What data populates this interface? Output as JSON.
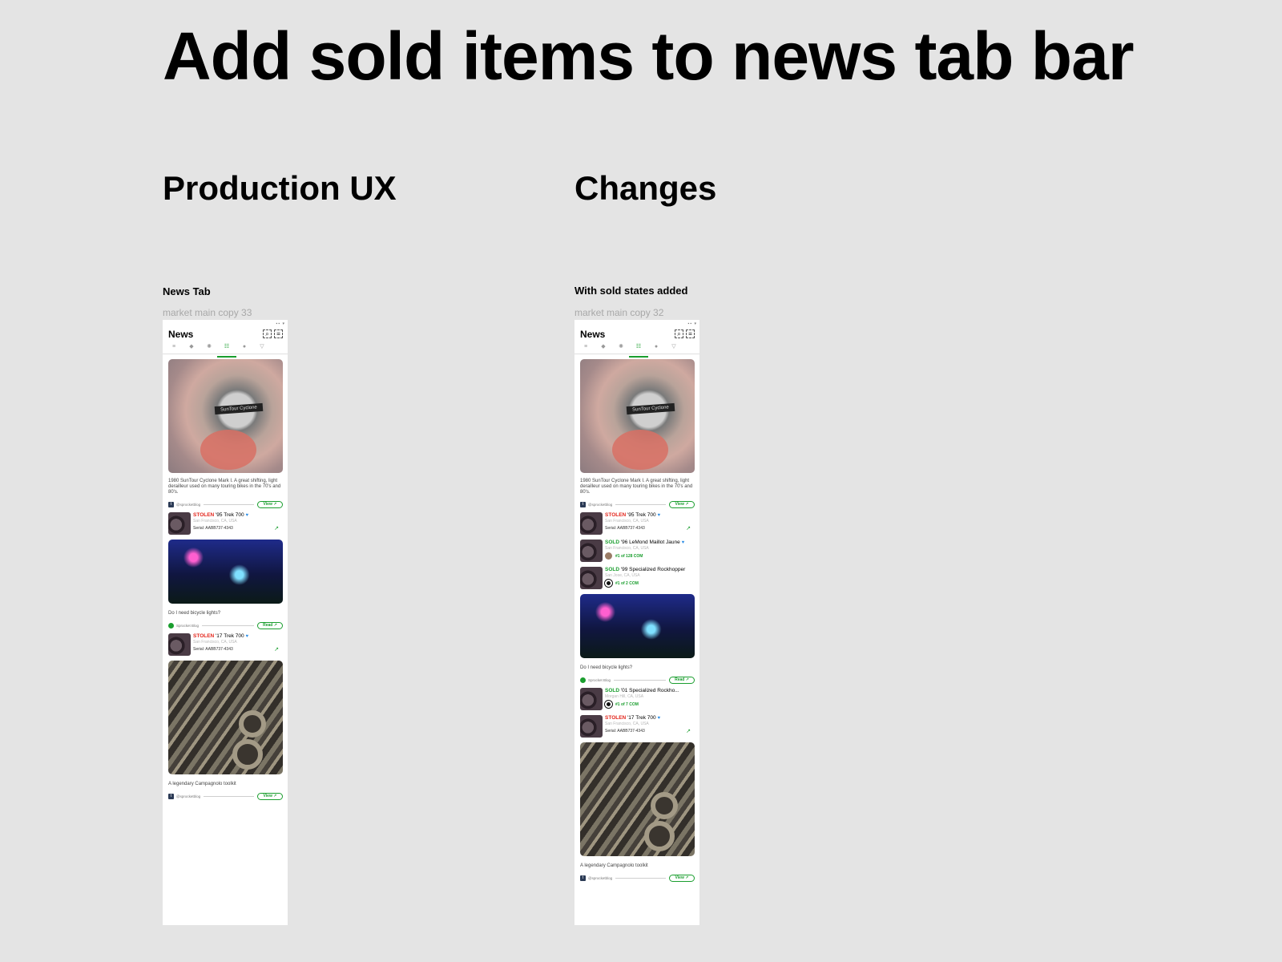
{
  "page": {
    "title": "Add sold items to news tab bar",
    "left_heading": "Production UX",
    "right_heading": "Changes"
  },
  "frames": [
    {
      "label": "News Tab",
      "sub": "market main copy 33",
      "app_title": "News",
      "tabs": [
        "menu-icon",
        "tag-icon",
        "wheel-icon",
        "news-icon",
        "person-icon",
        "filter-icon"
      ],
      "active_tab": 3,
      "feed": {
        "article1": {
          "caption": "1980 SunTour Cyclone Mark I. A great shifting, light derailleur used on many touring bikes in the 70's and 80's.",
          "source": "@sprocketblog",
          "button": "View",
          "image_text": "SunTour Cyclone"
        },
        "bike1": {
          "status": "STOLEN",
          "name": "'95 Trek 700",
          "location": "San Francisco, CA, USA",
          "serial": "Serial: AABB737-4343"
        },
        "article2": {
          "caption": "Do I need bicycle lights?",
          "source": "Sprocket Blog",
          "button": "Read"
        },
        "bike2": {
          "status": "STOLEN",
          "name": "'17 Trek 700",
          "location": "San Francisco, CA, USA",
          "serial": "Serial: AABB737-4343"
        },
        "article3": {
          "caption": "A legendary Campagnolo toolkit",
          "source": "@sprocketblog",
          "button": "View"
        }
      }
    },
    {
      "label": "With sold states added",
      "sub": "market main copy 32",
      "app_title": "News",
      "feed": {
        "article1": {
          "caption": "1980 SunTour Cyclone Mark I. A great shifting, light derailleur used on many touring bikes in the 70's and 80's.",
          "source": "@sprocketblog",
          "button": "View",
          "image_text": "SunTour Cyclone"
        },
        "bike1": {
          "status": "STOLEN",
          "name": "'95 Trek 700",
          "location": "San Francisco, CA, USA",
          "serial": "Serial: AABB737-4343"
        },
        "sold1": {
          "status": "SOLD",
          "name": "'96 LeMond Maillot Jaune",
          "location": "San Francisco, CA, USA",
          "rank": "#1 of 128 COM"
        },
        "sold2": {
          "status": "SOLD",
          "name": "'99 Specialized Rockhopper",
          "location": "San Jose, CA, USA",
          "rank": "#1 of 2 COM"
        },
        "article2": {
          "caption": "Do I need bicycle lights?",
          "source": "Sprocket Blog",
          "button": "Read"
        },
        "sold3": {
          "status": "SOLD",
          "name": "'01 Specialized Rockho...",
          "location": "Morgan Hill, CA, USA",
          "rank": "#1 of 7 COM"
        },
        "bike2": {
          "status": "STOLEN",
          "name": "'17 Trek 700",
          "location": "San Francisco, CA, USA",
          "serial": "Serial: AABB737-4343"
        },
        "article3": {
          "caption": "A legendary Campagnolo toolkit",
          "source": "@sprocketblog",
          "button": "View"
        }
      }
    }
  ],
  "colors": {
    "accent": "#1a9e2e",
    "stolen": "#e3251b",
    "verified": "#2f8fe6",
    "background": "#e4e4e4"
  }
}
